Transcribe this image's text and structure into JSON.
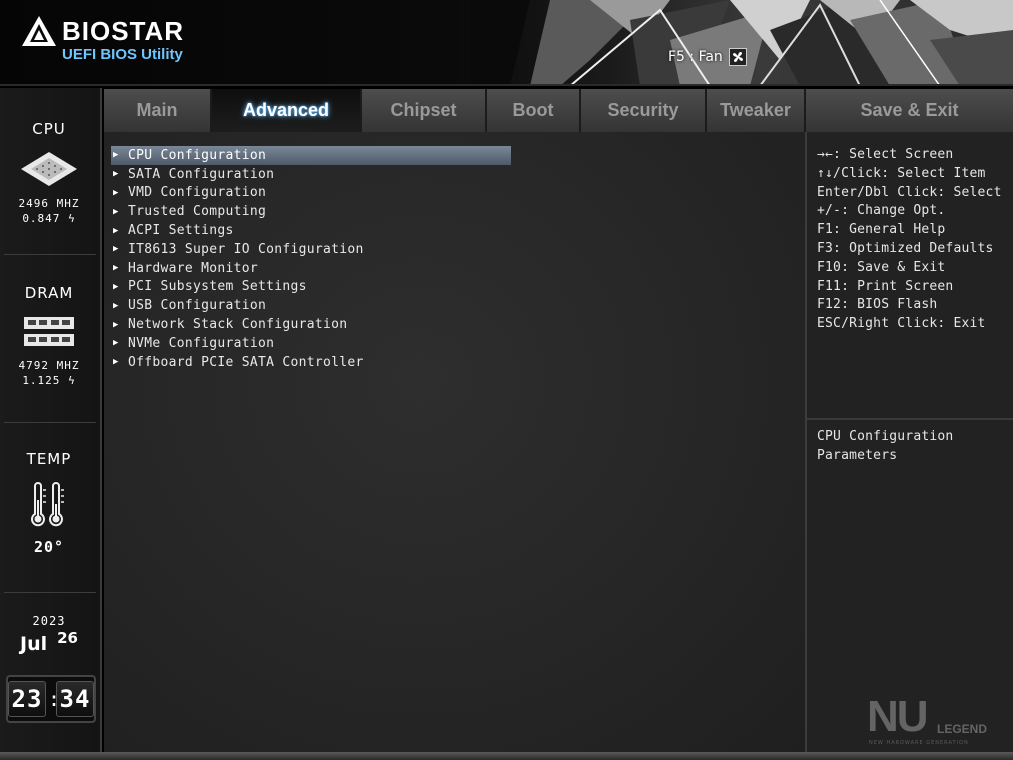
{
  "header": {
    "brand_name": "BIOSTAR",
    "brand_subtitle": "UEFI BIOS Utility",
    "fan_button_label": "F5 : Fan"
  },
  "sidebar": {
    "cpu": {
      "title": "CPU",
      "freq": "2496 MHZ",
      "volt": "0.847"
    },
    "dram": {
      "title": "DRAM",
      "freq": "4792 MHZ",
      "volt": "1.125"
    },
    "temp": {
      "title": "TEMP",
      "value": "20°"
    },
    "date": {
      "year": "2023",
      "month": "Jul",
      "day": "26"
    },
    "clock": {
      "hours": "23",
      "minutes": "34"
    }
  },
  "tabs": [
    {
      "label": "Main"
    },
    {
      "label": "Advanced"
    },
    {
      "label": "Chipset"
    },
    {
      "label": "Boot"
    },
    {
      "label": "Security"
    },
    {
      "label": "Tweaker"
    },
    {
      "label": "Save & Exit"
    }
  ],
  "active_tab": "Advanced",
  "menu": [
    {
      "label": "CPU Configuration"
    },
    {
      "label": "SATA Configuration"
    },
    {
      "label": "VMD Configuration"
    },
    {
      "label": "Trusted Computing"
    },
    {
      "label": "ACPI Settings"
    },
    {
      "label": "IT8613 Super IO Configuration"
    },
    {
      "label": "Hardware Monitor"
    },
    {
      "label": "PCI Subsystem Settings"
    },
    {
      "label": "USB Configuration"
    },
    {
      "label": "Network Stack Configuration"
    },
    {
      "label": "NVMe Configuration"
    },
    {
      "label": "Offboard PCIe SATA Controller"
    }
  ],
  "selected_menu_item": "CPU Configuration",
  "help": {
    "keys": [
      "→←: Select Screen",
      "↑↓/Click: Select Item",
      "Enter/Dbl Click: Select",
      "+/-: Change Opt.",
      "F1: General Help",
      "F3: Optimized Defaults",
      "F10: Save & Exit",
      "F11: Print Screen",
      "F12: BIOS Flash",
      "ESC/Right Click: Exit"
    ],
    "description_lines": [
      "CPU Configuration",
      "Parameters"
    ]
  },
  "watermark": {
    "text": "NU",
    "legend": "LEGEND",
    "sub": "NEW HARDWARE GENERATION"
  },
  "colors": {
    "accent_blue": "#6ec6ff",
    "selected_row": "#6a7788",
    "tab_inactive": "#404040",
    "tab_active": "#141414"
  }
}
